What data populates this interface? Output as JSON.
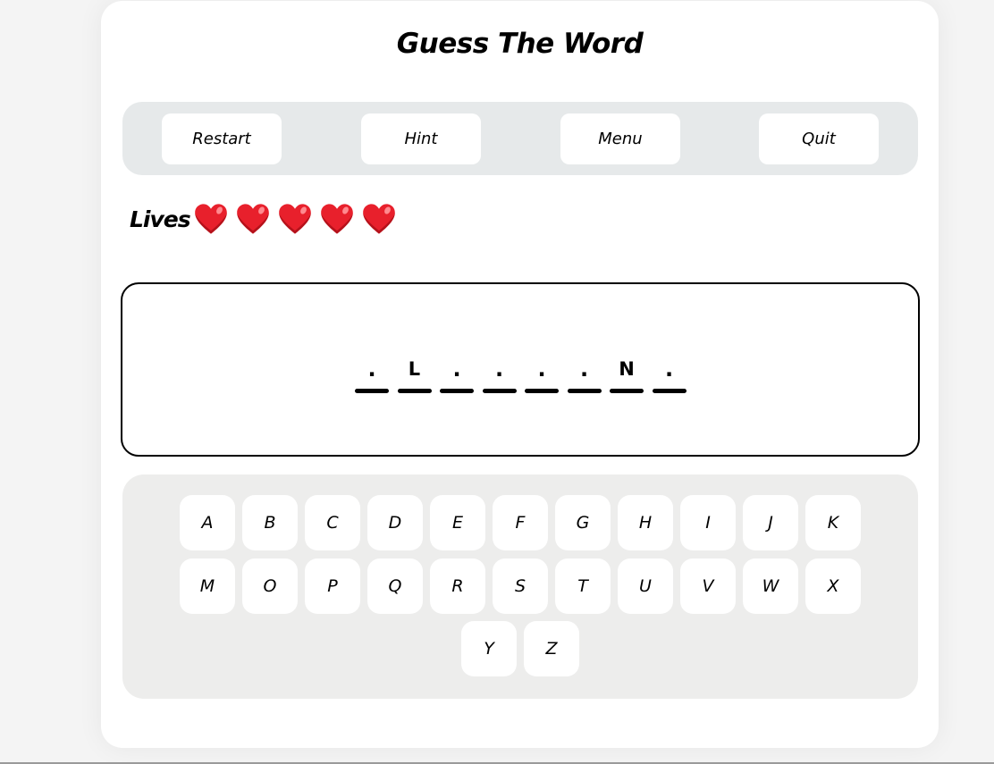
{
  "title": "Guess The Word",
  "menu": {
    "buttons": [
      "Restart",
      "Hint",
      "Menu",
      "Quit"
    ]
  },
  "lives": {
    "label": "Lives",
    "count": 5,
    "icon": "heart-icon",
    "color": "#e8202c"
  },
  "word": {
    "slots": [
      ".",
      "L",
      ".",
      ".",
      ".",
      ".",
      "N",
      "."
    ]
  },
  "keyboard": {
    "rows": [
      [
        "A",
        "B",
        "C",
        "D",
        "E",
        "F",
        "G",
        "H",
        "I",
        "J",
        "K"
      ],
      [
        "M",
        "O",
        "P",
        "Q",
        "R",
        "S",
        "T",
        "U",
        "V",
        "W",
        "X"
      ],
      [
        "Y",
        "Z"
      ]
    ]
  }
}
